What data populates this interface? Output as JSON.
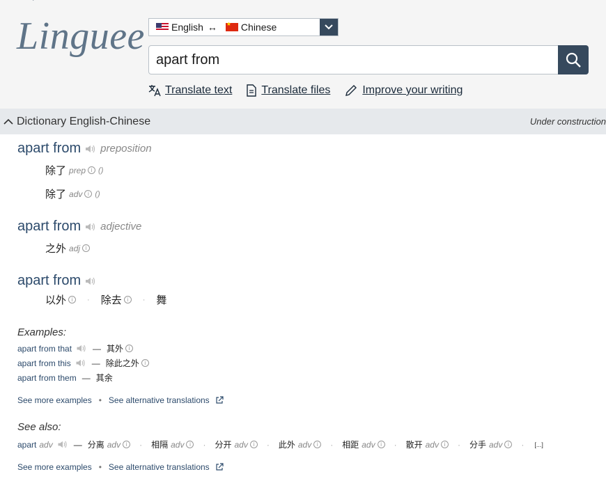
{
  "logo": "Linguee",
  "lang": {
    "from": "English",
    "arrows": "↔",
    "to": "Chinese"
  },
  "search": {
    "value": "apart from"
  },
  "toolbar": {
    "translate_text": "Translate text",
    "translate_files": "Translate files",
    "improve": "Improve your writing"
  },
  "dict_bar": {
    "title": "Dictionary English-Chinese",
    "status": "Under construction"
  },
  "entries": [
    {
      "word": "apart from",
      "pos": "preposition"
    },
    {
      "word": "apart from",
      "pos": "adjective"
    },
    {
      "word": "apart from"
    }
  ],
  "trans": {
    "t1": "除了",
    "t1_pos": "prep",
    "t1_paren": "()",
    "t2": "除了",
    "t2_pos": "adv",
    "t2_paren": "()",
    "t3": "之外",
    "t3_pos": "adj",
    "t4a": "以外",
    "t4b": "除去",
    "t4c": "舞"
  },
  "examples": {
    "label": "Examples:",
    "rows": [
      {
        "src": "apart from that",
        "tgt": "其外"
      },
      {
        "src": "apart from this",
        "tgt": "除此之外"
      },
      {
        "src": "apart from them",
        "tgt": "其余"
      }
    ]
  },
  "links": {
    "more": "See more examples",
    "alt": "See alternative translations"
  },
  "see_also": {
    "label": "See also:",
    "src": "apart",
    "src_pos": "adv",
    "items": [
      {
        "t": "分离",
        "p": "adv"
      },
      {
        "t": "相隔",
        "p": "adv"
      },
      {
        "t": "分开",
        "p": "adv"
      },
      {
        "t": "此外",
        "p": "adv"
      },
      {
        "t": "相距",
        "p": "adv"
      },
      {
        "t": "散开",
        "p": "adv"
      },
      {
        "t": "分手",
        "p": "adv"
      }
    ],
    "more": "[...]"
  },
  "colors": {
    "accent": "#36495d",
    "link": "#2c4a6b",
    "bar": "#e6e9ec"
  }
}
